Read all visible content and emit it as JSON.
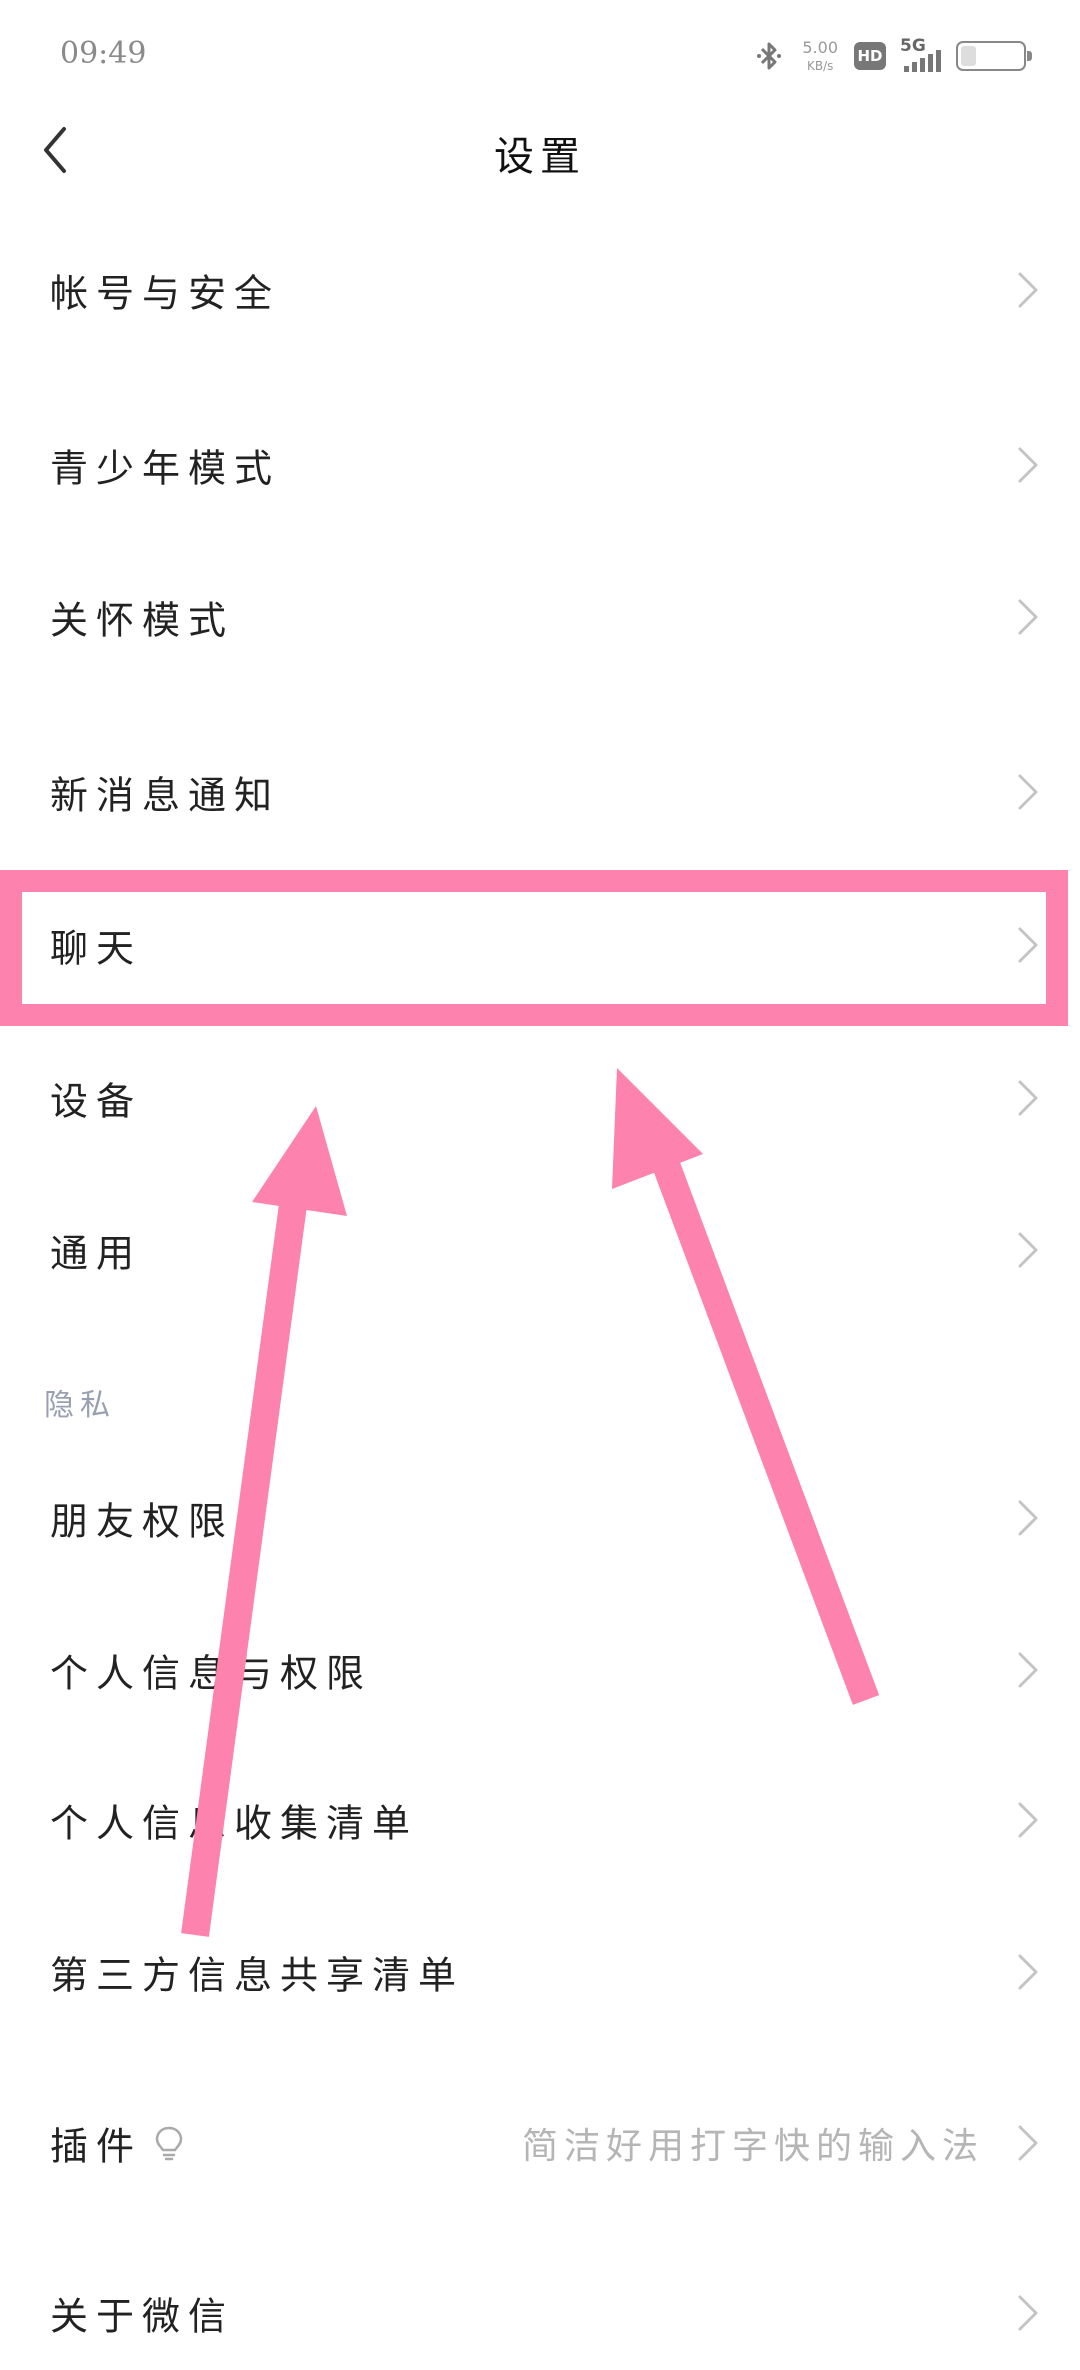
{
  "status_bar": {
    "time": "09:49",
    "net_speed_value": "5.00",
    "net_speed_unit": "KB/s",
    "hd_badge": "HD",
    "network_type": "5G",
    "icons": [
      "bluetooth-icon",
      "hd-icon",
      "signal-5g-icon",
      "battery-icon"
    ],
    "battery_level": 0.25
  },
  "header": {
    "title": "设置",
    "back_icon": "chevron-left-icon"
  },
  "settings": {
    "account_security": "帐号与安全",
    "youth_mode": "青少年模式",
    "care_mode": "关怀模式",
    "notifications": "新消息通知",
    "chat": "聊天",
    "devices": "设备",
    "general": "通用",
    "privacy_section": "隐私",
    "friend_permissions": "朋友权限",
    "personal_info_permissions": "个人信息与权限",
    "personal_info_list": "个人信息收集清单",
    "third_party_list": "第三方信息共享清单",
    "plugins": "插件",
    "plugins_value": "简洁好用打字快的输入法",
    "about": "关于微信"
  },
  "colors": {
    "highlight": "#fd82ad",
    "chevron": "#c4c4c4",
    "section_label": "#9aa0b0",
    "secondary_text": "#b5b5b5"
  },
  "annotation": {
    "highlighted_item": "聊天",
    "arrow_count": 2
  }
}
